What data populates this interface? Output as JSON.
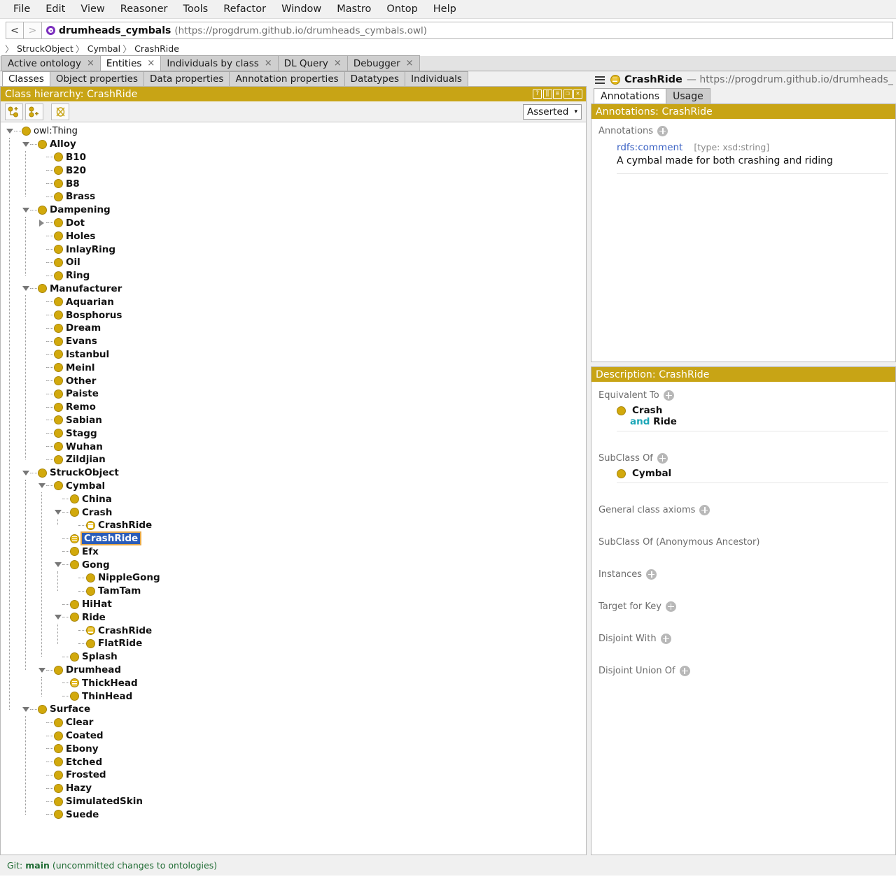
{
  "menu": {
    "items": [
      "File",
      "Edit",
      "View",
      "Reasoner",
      "Tools",
      "Refactor",
      "Window",
      "Mastro",
      "Ontop",
      "Help"
    ]
  },
  "navbar": {
    "back_label": "<",
    "forward_label": ">",
    "ontology_icon": "ontology-purple-circle-icon",
    "ontology_name": "drumheads_cymbals",
    "ontology_uri": "(https://progdrum.github.io/drumheads_cymbals.owl)"
  },
  "breadcrumb": {
    "items": [
      "StruckObject",
      "Cymbal",
      "CrashRide"
    ],
    "separator": "〉"
  },
  "workspace_tabs": [
    {
      "label": "Active ontology",
      "active": false,
      "close": "×"
    },
    {
      "label": "Entities",
      "active": true,
      "close": "×"
    },
    {
      "label": "Individuals by class",
      "active": false,
      "close": "×"
    },
    {
      "label": "DL Query",
      "active": false,
      "close": "×"
    },
    {
      "label": "Debugger",
      "active": false,
      "close": "×"
    }
  ],
  "category_tabs": [
    {
      "label": "Classes",
      "active": true
    },
    {
      "label": "Object properties",
      "active": false
    },
    {
      "label": "Data properties",
      "active": false
    },
    {
      "label": "Annotation properties",
      "active": false
    },
    {
      "label": "Datatypes",
      "active": false
    },
    {
      "label": "Individuals",
      "active": false
    }
  ],
  "class_hierarchy": {
    "panel_title": "Class hierarchy: CrashRide",
    "title_icons": [
      "help-icon",
      "split-icon",
      "minimize-icon",
      "maximize-icon",
      "close-icon"
    ],
    "toolbar_buttons": [
      "add-subclass-icon",
      "add-sibling-class-icon",
      "delete-class-icon"
    ],
    "view_mode": "Asserted",
    "view_mode_caret": "▾",
    "tree": [
      {
        "label": "owl:Thing",
        "depth": 0,
        "twisty": "down",
        "icon": "class",
        "bold": false
      },
      {
        "label": "Alloy",
        "depth": 1,
        "twisty": "down",
        "icon": "class",
        "bold": true
      },
      {
        "label": "B10",
        "depth": 2,
        "twisty": "none",
        "icon": "class",
        "bold": true
      },
      {
        "label": "B20",
        "depth": 2,
        "twisty": "none",
        "icon": "class",
        "bold": true
      },
      {
        "label": "B8",
        "depth": 2,
        "twisty": "none",
        "icon": "class",
        "bold": true
      },
      {
        "label": "Brass",
        "depth": 2,
        "twisty": "none",
        "icon": "class",
        "bold": true
      },
      {
        "label": "Dampening",
        "depth": 1,
        "twisty": "down",
        "icon": "class",
        "bold": true
      },
      {
        "label": "Dot",
        "depth": 2,
        "twisty": "right",
        "icon": "class",
        "bold": true
      },
      {
        "label": "Holes",
        "depth": 2,
        "twisty": "none",
        "icon": "class",
        "bold": true
      },
      {
        "label": "InlayRing",
        "depth": 2,
        "twisty": "none",
        "icon": "class",
        "bold": true
      },
      {
        "label": "Oil",
        "depth": 2,
        "twisty": "none",
        "icon": "class",
        "bold": true
      },
      {
        "label": "Ring",
        "depth": 2,
        "twisty": "none",
        "icon": "class",
        "bold": true
      },
      {
        "label": "Manufacturer",
        "depth": 1,
        "twisty": "down",
        "icon": "class",
        "bold": true
      },
      {
        "label": "Aquarian",
        "depth": 2,
        "twisty": "none",
        "icon": "class",
        "bold": true
      },
      {
        "label": "Bosphorus",
        "depth": 2,
        "twisty": "none",
        "icon": "class",
        "bold": true
      },
      {
        "label": "Dream",
        "depth": 2,
        "twisty": "none",
        "icon": "class",
        "bold": true
      },
      {
        "label": "Evans",
        "depth": 2,
        "twisty": "none",
        "icon": "class",
        "bold": true
      },
      {
        "label": "Istanbul",
        "depth": 2,
        "twisty": "none",
        "icon": "class",
        "bold": true
      },
      {
        "label": "Meinl",
        "depth": 2,
        "twisty": "none",
        "icon": "class",
        "bold": true
      },
      {
        "label": "Other",
        "depth": 2,
        "twisty": "none",
        "icon": "class",
        "bold": true
      },
      {
        "label": "Paiste",
        "depth": 2,
        "twisty": "none",
        "icon": "class",
        "bold": true
      },
      {
        "label": "Remo",
        "depth": 2,
        "twisty": "none",
        "icon": "class",
        "bold": true
      },
      {
        "label": "Sabian",
        "depth": 2,
        "twisty": "none",
        "icon": "class",
        "bold": true
      },
      {
        "label": "Stagg",
        "depth": 2,
        "twisty": "none",
        "icon": "class",
        "bold": true
      },
      {
        "label": "Wuhan",
        "depth": 2,
        "twisty": "none",
        "icon": "class",
        "bold": true
      },
      {
        "label": "Zildjian",
        "depth": 2,
        "twisty": "none",
        "icon": "class",
        "bold": true
      },
      {
        "label": "StruckObject",
        "depth": 1,
        "twisty": "down",
        "icon": "class",
        "bold": true
      },
      {
        "label": "Cymbal",
        "depth": 2,
        "twisty": "down",
        "icon": "class",
        "bold": true
      },
      {
        "label": "China",
        "depth": 3,
        "twisty": "none",
        "icon": "class",
        "bold": true
      },
      {
        "label": "Crash",
        "depth": 3,
        "twisty": "down",
        "icon": "class",
        "bold": true
      },
      {
        "label": "CrashRide",
        "depth": 4,
        "twisty": "none",
        "icon": "defined",
        "bold": true
      },
      {
        "label": "CrashRide",
        "depth": 3,
        "twisty": "none",
        "icon": "defined",
        "bold": true,
        "selected": true
      },
      {
        "label": "Efx",
        "depth": 3,
        "twisty": "none",
        "icon": "class",
        "bold": true
      },
      {
        "label": "Gong",
        "depth": 3,
        "twisty": "down",
        "icon": "class",
        "bold": true
      },
      {
        "label": "NippleGong",
        "depth": 4,
        "twisty": "none",
        "icon": "class",
        "bold": true
      },
      {
        "label": "TamTam",
        "depth": 4,
        "twisty": "none",
        "icon": "class",
        "bold": true
      },
      {
        "label": "HiHat",
        "depth": 3,
        "twisty": "none",
        "icon": "class",
        "bold": true
      },
      {
        "label": "Ride",
        "depth": 3,
        "twisty": "down",
        "icon": "class",
        "bold": true
      },
      {
        "label": "CrashRide",
        "depth": 4,
        "twisty": "none",
        "icon": "defined",
        "bold": true
      },
      {
        "label": "FlatRide",
        "depth": 4,
        "twisty": "none",
        "icon": "class",
        "bold": true
      },
      {
        "label": "Splash",
        "depth": 3,
        "twisty": "none",
        "icon": "class",
        "bold": true
      },
      {
        "label": "Drumhead",
        "depth": 2,
        "twisty": "down",
        "icon": "class",
        "bold": true
      },
      {
        "label": "ThickHead",
        "depth": 3,
        "twisty": "none",
        "icon": "defined",
        "bold": true
      },
      {
        "label": "ThinHead",
        "depth": 3,
        "twisty": "none",
        "icon": "class",
        "bold": true
      },
      {
        "label": "Surface",
        "depth": 1,
        "twisty": "down",
        "icon": "class",
        "bold": true
      },
      {
        "label": "Clear",
        "depth": 2,
        "twisty": "none",
        "icon": "class",
        "bold": true
      },
      {
        "label": "Coated",
        "depth": 2,
        "twisty": "none",
        "icon": "class",
        "bold": true
      },
      {
        "label": "Ebony",
        "depth": 2,
        "twisty": "none",
        "icon": "class",
        "bold": true
      },
      {
        "label": "Etched",
        "depth": 2,
        "twisty": "none",
        "icon": "class",
        "bold": true
      },
      {
        "label": "Frosted",
        "depth": 2,
        "twisty": "none",
        "icon": "class",
        "bold": true
      },
      {
        "label": "Hazy",
        "depth": 2,
        "twisty": "none",
        "icon": "class",
        "bold": true
      },
      {
        "label": "SimulatedSkin",
        "depth": 2,
        "twisty": "none",
        "icon": "class",
        "bold": true
      },
      {
        "label": "Suede",
        "depth": 2,
        "twisty": "none",
        "icon": "class",
        "bold": true
      }
    ]
  },
  "entity_panel": {
    "hamburger_icon": "hamburger-menu-icon",
    "entity_icon": "defined-class-icon",
    "entity_name": "CrashRide",
    "entity_uri": "— https://progdrum.github.io/drumheads_",
    "tabs": [
      {
        "label": "Annotations",
        "active": true
      },
      {
        "label": "Usage",
        "active": false
      }
    ]
  },
  "annotations": {
    "panel_title": "Annotations: CrashRide",
    "section_label": "Annotations",
    "rows": [
      {
        "property": "rdfs:comment",
        "type": "[type: xsd:string]",
        "value": "A cymbal made for both crashing and riding"
      }
    ]
  },
  "description": {
    "panel_title": "Description: CrashRide",
    "blocks": [
      {
        "label": "Equivalent To",
        "has_add": true,
        "items": [
          {
            "icon": "class",
            "text": "Crash",
            "sub_keyword": "and",
            "sub_text": "Ride"
          }
        ],
        "divider": true
      },
      {
        "label": "SubClass Of",
        "has_add": true,
        "items": [
          {
            "icon": "class",
            "text": "Cymbal"
          }
        ],
        "divider": true
      },
      {
        "label": "General class axioms",
        "has_add": true,
        "items": [],
        "divider": false
      },
      {
        "label": "SubClass Of (Anonymous Ancestor)",
        "has_add": false,
        "items": [],
        "divider": false
      },
      {
        "label": "Instances",
        "has_add": true,
        "items": [],
        "divider": false
      },
      {
        "label": "Target for Key",
        "has_add": true,
        "items": [],
        "divider": false
      },
      {
        "label": "Disjoint With",
        "has_add": true,
        "items": [],
        "divider": false
      },
      {
        "label": "Disjoint Union Of",
        "has_add": true,
        "items": [],
        "divider": false
      }
    ]
  },
  "statusbar": {
    "prefix": "Git:",
    "branch": "main",
    "suffix": "(uncommitted changes to ontologies)"
  },
  "colors": {
    "panel_gold": "#c8a415",
    "class_icon": "#d2a90c",
    "selection_blue": "#2a5cb8",
    "selection_border": "#e6a94a",
    "link_blue": "#3b62c4",
    "keyword_cyan": "#1aa6b7",
    "git_green": "#1f6b33",
    "ontology_purple": "#7b2fbe"
  }
}
